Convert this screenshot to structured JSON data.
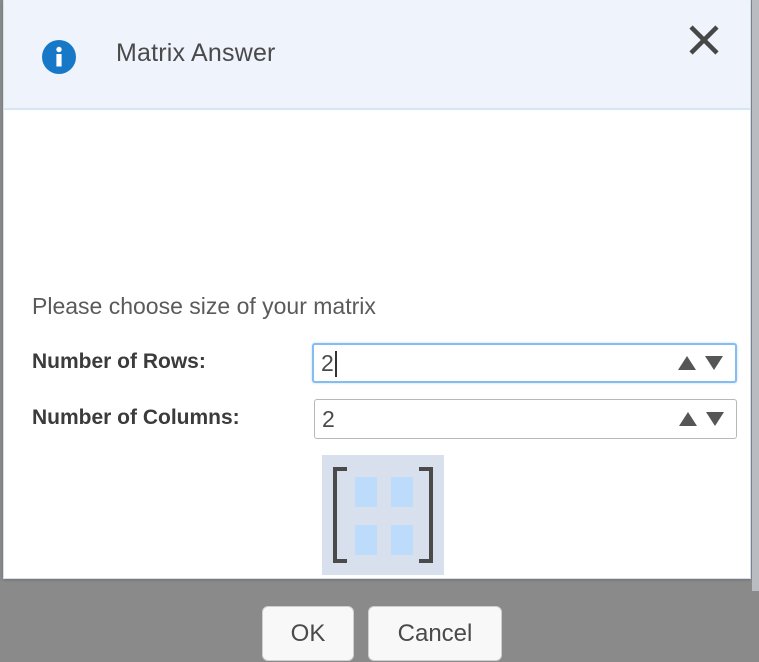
{
  "dialog": {
    "title": "Matrix Answer",
    "title_icon": "info-circle-icon",
    "close_icon": "close-x-icon",
    "close_label": "X",
    "prompt": "Please choose size of your matrix",
    "accent_color": "#1878c8",
    "header_background": "#eef3fc",
    "border_color": "#cfe0f2"
  },
  "fields": [
    {
      "label": "Number of Rows:",
      "value": "2",
      "focused": true,
      "increment_icon": "triangle-up-icon",
      "decrement_icon": "triangle-down-icon"
    },
    {
      "label": "Number of Columns:",
      "value": "2",
      "focused": false,
      "increment_icon": "triangle-up-icon",
      "decrement_icon": "triangle-down-icon"
    }
  ],
  "preview": {
    "rows": 2,
    "columns": 2,
    "cell_color": "#bddcfc",
    "background_color": "#d9e0ed",
    "bracket_color": "#4a4a4a"
  },
  "buttons": {
    "ok": "OK",
    "cancel": "Cancel"
  }
}
